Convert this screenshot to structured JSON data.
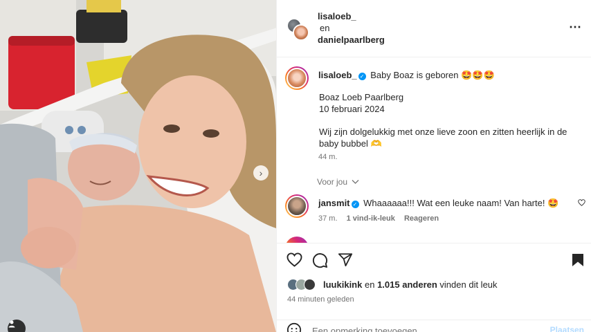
{
  "header": {
    "user1": "lisaloeb_",
    "connector": "en",
    "user2": "danielpaarlberg",
    "more_icon": "more-horizontal-icon"
  },
  "caption": {
    "username": "lisaloeb_",
    "title": "Baby Boaz is geboren 🤩🤩🤩",
    "lines": [
      "Boaz Loeb Paarlberg",
      "10 februari 2024"
    ],
    "paragraph": "Wij zijn dolgelukkig met onze lieve zoon en zitten heerlijk in de baby bubbel 🫶",
    "time": "44 m."
  },
  "view_replies": "Voor jou",
  "comment": {
    "username": "jansmit",
    "text": "Whaaaaaa!!! Wat een leuke naam! Van harte! 🤩",
    "time": "37 m.",
    "likes": "1 vind-ik-leuk",
    "reply": "Reageren"
  },
  "likes": {
    "first_liker": "luukikink",
    "connector": "en",
    "others": "1.015 anderen",
    "suffix": "vinden dit leuk"
  },
  "timestamp": "44 minuten geleden",
  "comment_input": {
    "placeholder": "Een opmerking toevoegen...",
    "post_label": "Plaatsen"
  },
  "colors": {
    "verified": "#0095f6",
    "post_disabled": "#b3dbff",
    "muted": "#737373"
  }
}
